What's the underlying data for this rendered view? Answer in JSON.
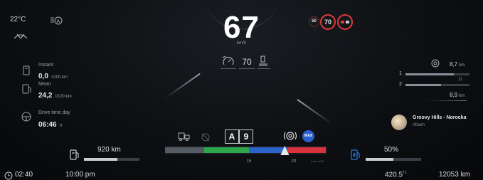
{
  "status": {
    "outside_temp": "22°C",
    "clock_trip": "02:40",
    "time": "10:00 pm",
    "headlight_icon": "auto-headlight-icon",
    "ac_icon": "wiper-icon"
  },
  "speed": {
    "value": "67",
    "unit": "km/h"
  },
  "speed_signs": {
    "small_limit": "50",
    "limit": "70",
    "overtake_icon": "no-overtaking-icon"
  },
  "cruise": {
    "icon": "cruise-control-icon",
    "set_speed": "70",
    "seat_icon": "driver-seat-icon"
  },
  "consumption": {
    "instant_label": "Instant",
    "instant_value": "0,0",
    "instant_unit": "l/100 km",
    "mean_label": "Mean",
    "mean_value": "24,2",
    "mean_unit": "l/100 km"
  },
  "drive_time": {
    "label": "Drive time day",
    "value": "06:46",
    "unit": "h"
  },
  "fuel": {
    "range": "920 km",
    "level": 0.6
  },
  "adblue": {
    "percent_label": "50%",
    "level": 0.5
  },
  "gear": {
    "mode": "A",
    "number": "9"
  },
  "rpm": {
    "tick_15": "15",
    "tick_20": "20",
    "unit": "rpm x 100",
    "current": 19
  },
  "brake": {
    "mode": "MAX"
  },
  "media": {
    "title": "Groovy Hills - Norocka",
    "subtitle": "Album"
  },
  "axles": {
    "top_value": "8,7",
    "top_unit": "km",
    "row1_label": "1",
    "row2_label": "2",
    "tick_11": "11",
    "bottom_value": "8,9",
    "bottom_unit": "km",
    "row1_level": 0.75,
    "row2_level": 0.55
  },
  "odometer": {
    "trip": "420.5",
    "trip_unit": "T1",
    "total": "12053 km"
  },
  "colors": {
    "rpm_green": "#2ea64a",
    "rpm_blue": "#2a63c9",
    "rpm_red": "#d8333c",
    "alert_red": "#e23a3a",
    "fuel_blue": "#2a7ad9"
  }
}
